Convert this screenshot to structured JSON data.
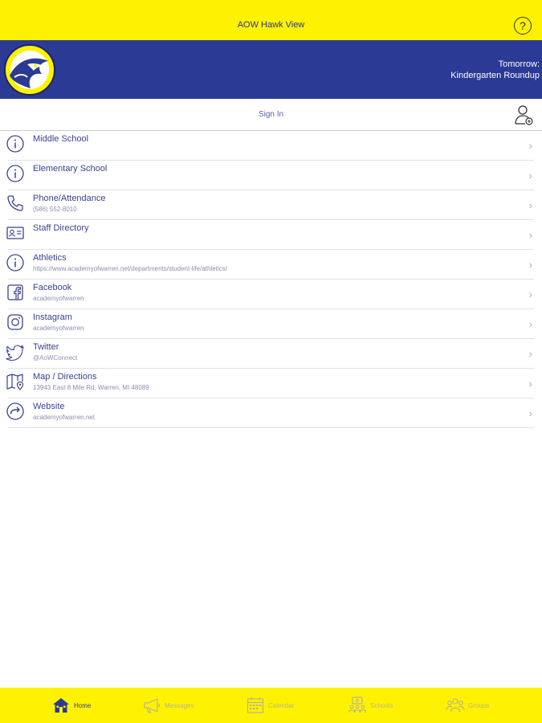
{
  "header": {
    "title": "AOW Hawk View",
    "help_glyph": "?"
  },
  "banner": {
    "upcoming_line1": "Tomorrow:",
    "upcoming_line2": "Kindergarten Roundup"
  },
  "signin": {
    "label": "Sign In"
  },
  "list": [
    {
      "icon": "info-icon",
      "label": "Middle School",
      "sub": ""
    },
    {
      "icon": "info-icon",
      "label": "Elementary School",
      "sub": ""
    },
    {
      "icon": "phone-icon",
      "label": "Phone/Attendance",
      "sub": "(586) 552-8010"
    },
    {
      "icon": "contact-card-icon",
      "label": "Staff Directory",
      "sub": ""
    },
    {
      "icon": "info-icon",
      "label": "Athletics",
      "sub": "https://www.academyofwarren.net/departments/student-life/athletics/"
    },
    {
      "icon": "facebook-icon",
      "label": "Facebook",
      "sub": "academyofwarren"
    },
    {
      "icon": "instagram-icon",
      "label": "Instagram",
      "sub": "academyofwarren"
    },
    {
      "icon": "twitter-icon",
      "label": "Twitter",
      "sub": "@AoWConnect"
    },
    {
      "icon": "map-icon",
      "label": "Map / Directions",
      "sub": "13943 East 8 Mile Rd, Warren, MI 48089"
    },
    {
      "icon": "website-icon",
      "label": "Website",
      "sub": "academyofwarren.net"
    }
  ],
  "tabs": [
    {
      "icon": "home-icon",
      "label": "Home",
      "active": true
    },
    {
      "icon": "megaphone-icon",
      "label": "Messages",
      "active": false
    },
    {
      "icon": "calendar-icon",
      "label": "Calendar",
      "active": false
    },
    {
      "icon": "schools-icon",
      "label": "Schools",
      "active": false
    },
    {
      "icon": "groups-icon",
      "label": "Groups",
      "active": false
    }
  ],
  "colors": {
    "yellow": "#fff200",
    "navy": "#2b3a94",
    "text": "#2b3585"
  }
}
